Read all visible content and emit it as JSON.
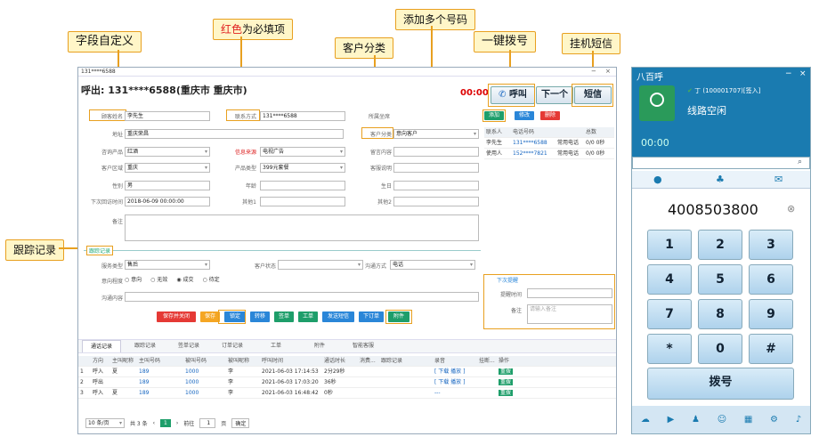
{
  "callouts": {
    "custom_fields": "字段自定义",
    "required_red": "红色",
    "required_rest": "为必填项",
    "multi_number": "添加多个号码",
    "customer_class": "客户分类",
    "one_click": "一键拨号",
    "hangup_sms": "挂机短信",
    "tracking": "跟踪记录"
  },
  "window": {
    "title": "131****6588",
    "call_info": "呼出: 131****6588(重庆市 重庆市)",
    "timer": "00:00",
    "call_btn": "呼叫",
    "next_btn": "下一个",
    "sms_btn": "短信",
    "min": "−",
    "close": "×"
  },
  "form": {
    "name_label": "顾客姓名",
    "name": "李先生",
    "contact_label": "联系方式",
    "contact": "131****6588",
    "owner_label": "所属坐席",
    "addr_label": "地址",
    "addr": "重庆荣昌",
    "class_label": "客户分类",
    "class_value": "意向客户",
    "product_label": "咨询产品",
    "product": "红酒",
    "source_label": "信息来源",
    "source": "电视广告",
    "msg_label": "留言内容",
    "region_label": "客户区域",
    "region": "重庆",
    "ptype_label": "产品类型",
    "ptype": "399元套餐",
    "note_label": "客服说明",
    "gender_label": "性别",
    "gender": "男",
    "age_label": "年龄",
    "birth_label": "生日",
    "next_label": "下次回访时间",
    "next_time": "2018-06-09 00:00:00",
    "other1_label": "其他1",
    "other2_label": "其他2",
    "remark_label": "备注"
  },
  "contacts": {
    "add": "添加",
    "edit": "修改",
    "del": "删除",
    "headers": [
      "联系人",
      "电话号码",
      "",
      "总数"
    ],
    "rows": [
      [
        "李先生",
        "131****6588",
        "常用电话",
        "0/0 0秒"
      ],
      [
        "使用人",
        "152****7821",
        "常用电话",
        "0/0 0秒"
      ]
    ]
  },
  "track": {
    "legend": "跟踪记录",
    "svc_label": "服务类型",
    "svc": "售后",
    "status_label": "客户状态",
    "method_label": "沟通方式",
    "method": "电话",
    "level_label": "意向程度",
    "levels": [
      "意向",
      "无效",
      "成交",
      "待定"
    ],
    "content_label": "沟通内容"
  },
  "next_visit": {
    "legend": "下次提醒",
    "time_label": "提醒时间",
    "remark_label": "备注",
    "placeholder": "请输入备注"
  },
  "actions": [
    "保存并关闭",
    "保存",
    "锁定",
    "转移",
    "签单",
    "工单",
    "发送短信",
    "下订单",
    "附件"
  ],
  "tabs": [
    "通话记录",
    "跟踪记录",
    "签单记录",
    "订单记录",
    "工单",
    "附件",
    "智能客服"
  ],
  "calls": {
    "headers": [
      "",
      "方向",
      "主叫昵称",
      "主叫号码",
      "被叫号码",
      "被叫昵称",
      "呼叫时间",
      "通话时长",
      "消费...",
      "跟踪记录",
      "录音",
      "挂断...",
      "操作"
    ],
    "rows": [
      [
        "1",
        "呼入",
        "夏",
        "189",
        "1000",
        "李",
        "2021-06-03 17:14:53",
        "2分29秒",
        "",
        "",
        "[ 下载 播放 ]",
        "",
        "重拨"
      ],
      [
        "2",
        "呼出",
        "",
        "189",
        "1000",
        "李",
        "2021-06-03 17:03:20",
        "36秒",
        "",
        "",
        "[ 下载 播放 ]",
        "",
        "重拨"
      ],
      [
        "3",
        "呼入",
        "夏",
        "189",
        "1000",
        "李",
        "2021-06-03 16:48:42",
        "0秒",
        "",
        "",
        "---",
        "",
        "重拨"
      ]
    ]
  },
  "pager": {
    "size": "10 条/页",
    "total": "共 3 条",
    "page": "1",
    "goto": "前往",
    "pageval": "1",
    "unit": "页",
    "ok": "确定"
  },
  "phone": {
    "title": "八百呼",
    "user": "丁 (100001707)[签入]",
    "status": "线路空闲",
    "timer": "00:00",
    "number": "4008503800",
    "keys": [
      "1",
      "2",
      "3",
      "4",
      "5",
      "6",
      "7",
      "8",
      "9",
      "*",
      "0",
      "#"
    ],
    "dial": "拨号"
  }
}
